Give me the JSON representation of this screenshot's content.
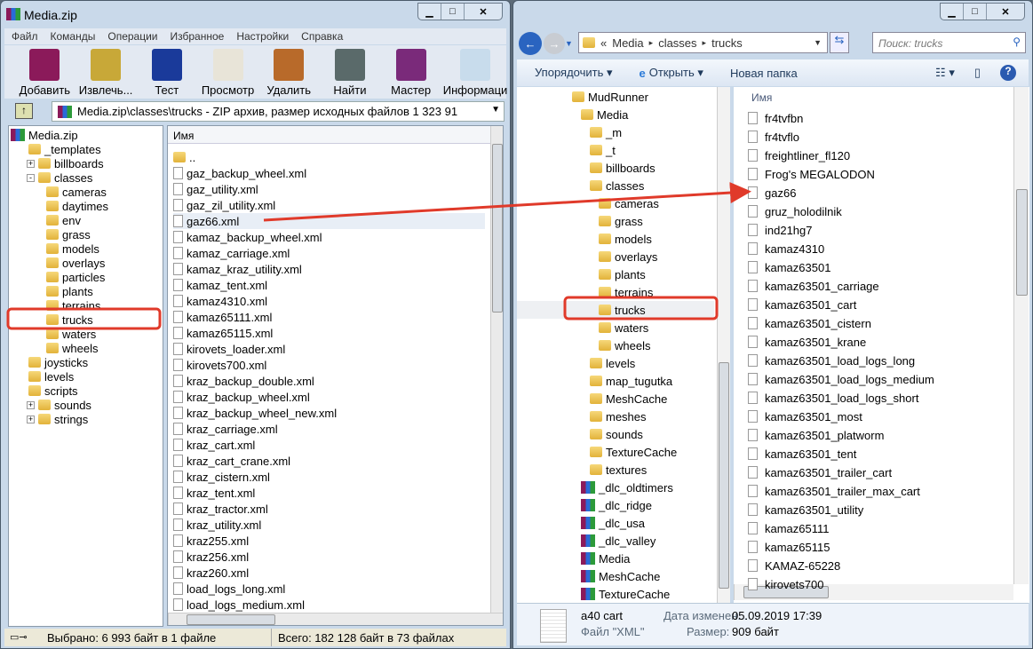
{
  "left": {
    "title": "Media.zip",
    "menu": [
      "Файл",
      "Команды",
      "Операции",
      "Избранное",
      "Настройки",
      "Справка"
    ],
    "toolbar": [
      {
        "label": "Добавить",
        "color": "#8b1a5a"
      },
      {
        "label": "Извлечь...",
        "color": "#c8a838"
      },
      {
        "label": "Тест",
        "color": "#1a3a9a"
      },
      {
        "label": "Просмотр",
        "color": "#e8e4d8"
      },
      {
        "label": "Удалить",
        "color": "#b86a2a"
      },
      {
        "label": "Найти",
        "color": "#5a6a6a"
      },
      {
        "label": "Мастер",
        "color": "#7a2a7a"
      },
      {
        "label": "Информаци",
        "color": "#c8dcec"
      }
    ],
    "address": "Media.zip\\classes\\trucks - ZIP архив, размер исходных файлов 1 323 91",
    "tree": [
      {
        "t": "Media.zip",
        "l": 0,
        "rar": true
      },
      {
        "t": "_templates",
        "l": 1
      },
      {
        "t": "billboards",
        "l": 1,
        "exp": "+"
      },
      {
        "t": "classes",
        "l": 1,
        "exp": "-"
      },
      {
        "t": "cameras",
        "l": 2
      },
      {
        "t": "daytimes",
        "l": 2
      },
      {
        "t": "env",
        "l": 2
      },
      {
        "t": "grass",
        "l": 2
      },
      {
        "t": "models",
        "l": 2
      },
      {
        "t": "overlays",
        "l": 2
      },
      {
        "t": "particles",
        "l": 2
      },
      {
        "t": "plants",
        "l": 2
      },
      {
        "t": "terrains",
        "l": 2
      },
      {
        "t": "trucks",
        "l": 2,
        "sel": true
      },
      {
        "t": "waters",
        "l": 2
      },
      {
        "t": "wheels",
        "l": 2
      },
      {
        "t": "joysticks",
        "l": 1
      },
      {
        "t": "levels",
        "l": 1
      },
      {
        "t": "scripts",
        "l": 1
      },
      {
        "t": "sounds",
        "l": 1,
        "exp": "+"
      },
      {
        "t": "strings",
        "l": 1,
        "exp": "+"
      }
    ],
    "column": "Имя",
    "files": [
      "..",
      "gaz_backup_wheel.xml",
      "gaz_utility.xml",
      "gaz_zil_utility.xml",
      "gaz66.xml",
      "kamaz_backup_wheel.xml",
      "kamaz_carriage.xml",
      "kamaz_kraz_utility.xml",
      "kamaz_tent.xml",
      "kamaz4310.xml",
      "kamaz65111.xml",
      "kamaz65115.xml",
      "kirovets_loader.xml",
      "kirovets700.xml",
      "kraz_backup_double.xml",
      "kraz_backup_wheel.xml",
      "kraz_backup_wheel_new.xml",
      "kraz_carriage.xml",
      "kraz_cart.xml",
      "kraz_cart_crane.xml",
      "kraz_cistern.xml",
      "kraz_tent.xml",
      "kraz_tractor.xml",
      "kraz_utility.xml",
      "kraz255.xml",
      "kraz256.xml",
      "kraz260.xml",
      "load_logs_long.xml",
      "load_logs_medium.xml"
    ],
    "selected_file": "gaz66.xml",
    "status_selected": "Выбрано: 6 993 байт в 1 файле",
    "status_total": "Всего: 182 128 байт в 73 файлах"
  },
  "right": {
    "breadcrumb": [
      "«",
      "Media",
      "classes",
      "trucks"
    ],
    "search_placeholder": "Поиск: trucks",
    "commands": {
      "organize": "Упорядочить",
      "open": "Открыть",
      "new_folder": "Новая папка"
    },
    "tree": [
      {
        "t": "MudRunner",
        "l": 0
      },
      {
        "t": "Media",
        "l": 1
      },
      {
        "t": "_m",
        "l": 2
      },
      {
        "t": "_t",
        "l": 2
      },
      {
        "t": "billboards",
        "l": 2
      },
      {
        "t": "classes",
        "l": 2
      },
      {
        "t": "cameras",
        "l": 3
      },
      {
        "t": "grass",
        "l": 3
      },
      {
        "t": "models",
        "l": 3
      },
      {
        "t": "overlays",
        "l": 3
      },
      {
        "t": "plants",
        "l": 3
      },
      {
        "t": "terrains",
        "l": 3
      },
      {
        "t": "trucks",
        "l": 3,
        "sel": true
      },
      {
        "t": "waters",
        "l": 3
      },
      {
        "t": "wheels",
        "l": 3
      },
      {
        "t": "levels",
        "l": 2
      },
      {
        "t": "map_tugutka",
        "l": 2
      },
      {
        "t": "MeshCache",
        "l": 2
      },
      {
        "t": "meshes",
        "l": 2
      },
      {
        "t": "sounds",
        "l": 2
      },
      {
        "t": "TextureCache",
        "l": 2
      },
      {
        "t": "textures",
        "l": 2
      },
      {
        "t": "_dlc_oldtimers",
        "l": 1,
        "rar": true
      },
      {
        "t": "_dlc_ridge",
        "l": 1,
        "rar": true
      },
      {
        "t": "_dlc_usa",
        "l": 1,
        "rar": true
      },
      {
        "t": "_dlc_valley",
        "l": 1,
        "rar": true
      },
      {
        "t": "Media",
        "l": 1,
        "rar": true
      },
      {
        "t": "MeshCache",
        "l": 1,
        "rar": true
      },
      {
        "t": "TextureCache",
        "l": 1,
        "rar": true
      }
    ],
    "column": "Имя",
    "files": [
      "fr4tvfbn",
      "fr4tvflo",
      "freightliner_fl120",
      "Frog's MEGALODON",
      "gaz66",
      "gruz_holodilnik",
      "ind21hg7",
      "kamaz4310",
      "kamaz63501",
      "kamaz63501_carriage",
      "kamaz63501_cart",
      "kamaz63501_cistern",
      "kamaz63501_krane",
      "kamaz63501_load_logs_long",
      "kamaz63501_load_logs_medium",
      "kamaz63501_load_logs_short",
      "kamaz63501_most",
      "kamaz63501_platworm",
      "kamaz63501_tent",
      "kamaz63501_trailer_cart",
      "kamaz63501_trailer_max_cart",
      "kamaz63501_utility",
      "kamaz65111",
      "kamaz65115",
      "KAMAZ-65228",
      "kirovets700"
    ],
    "details": {
      "name": "a40 cart",
      "type": "Файл \"XML\"",
      "date_label": "Дата изменен...",
      "date": "05.09.2019 17:39",
      "size_label": "Размер:",
      "size": "909 байт"
    }
  },
  "annotation_color": "#e03a2a"
}
